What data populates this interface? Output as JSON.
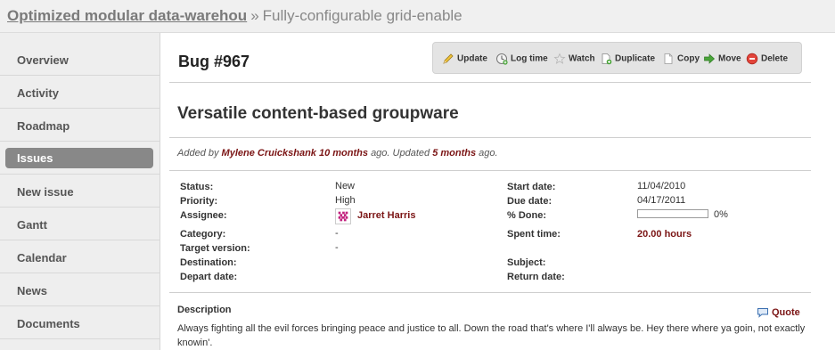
{
  "breadcrumb": {
    "project": "Optimized modular data-warehou",
    "separator": "»",
    "current": "Fully-configurable grid-enable"
  },
  "sidebar": {
    "items": [
      {
        "label": "Overview",
        "selected": false
      },
      {
        "label": "Activity",
        "selected": false
      },
      {
        "label": "Roadmap",
        "selected": false
      },
      {
        "label": "Issues",
        "selected": true
      },
      {
        "label": "New issue",
        "selected": false
      },
      {
        "label": "Gantt",
        "selected": false
      },
      {
        "label": "Calendar",
        "selected": false
      },
      {
        "label": "News",
        "selected": false
      },
      {
        "label": "Documents",
        "selected": false
      }
    ]
  },
  "issue": {
    "title": "Bug #967",
    "subject": "Versatile content-based groupware",
    "added_prefix": "Added by",
    "author": "Mylene Cruickshank",
    "created_ago": "10 months",
    "updated_mid": "ago. Updated",
    "updated_ago": "5 months",
    "ago_suffix": "ago."
  },
  "toolbar": {
    "update": "Update",
    "log_time": "Log time",
    "watch": "Watch",
    "duplicate": "Duplicate",
    "copy": "Copy",
    "move": "Move",
    "delete": "Delete"
  },
  "attributes": {
    "status_label": "Status:",
    "status": "New",
    "priority_label": "Priority:",
    "priority": "High",
    "assignee_label": "Assignee:",
    "assignee": "Jarret Harris",
    "category_label": "Category:",
    "category": "-",
    "target_version_label": "Target version:",
    "target_version": "-",
    "destination_label": "Destination:",
    "depart_date_label": "Depart date:",
    "start_date_label": "Start date:",
    "start_date": "11/04/2010",
    "due_date_label": "Due date:",
    "due_date": "04/17/2011",
    "done_label": "% Done:",
    "done_percent": 0,
    "done_text": "0%",
    "spent_time_label": "Spent time:",
    "spent_time": "20.00 hours",
    "subject_label": "Subject:",
    "return_date_label": "Return date:"
  },
  "description": {
    "heading": "Description",
    "quote_label": "Quote",
    "text": "Always fighting all the evil forces bringing peace and justice to all. Down the road that's where I'll always be. Hey there where ya goin, not exactly knowin'."
  },
  "colors": {
    "link": "#7b1515",
    "selected_nav": "#888888",
    "progress": "#b0cdea"
  }
}
